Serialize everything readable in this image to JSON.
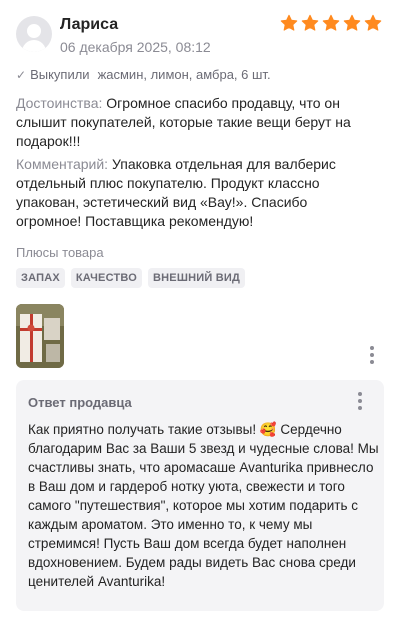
{
  "review": {
    "author": "Лариса",
    "date": "06 декабря 2025, 08:12",
    "rating": 5,
    "star_color": "#ff8a1f",
    "bought": {
      "label": "Выкупили",
      "value": "жасмин, лимон, амбра, 6 шт."
    },
    "advantages": {
      "label": "Достоинства:",
      "text": "Огромное спасибо продавцу, что он слышит покупателей, которые такие вещи берут на подарок!!!"
    },
    "comment": {
      "label": "Комментарий:",
      "text": "Упаковка отдельная для валберис отдельный плюс покупателю. Продукт классно упакован, эстетический вид «Вау!». Спасибо огромное! Поставщика рекомендую!"
    },
    "pluses_title": "Плюсы товара",
    "tags": [
      "ЗАПАХ",
      "КАЧЕСТВО",
      "ВНЕШНИЙ ВИД"
    ]
  },
  "seller_reply": {
    "title": "Ответ продавца",
    "text": "Как приятно получать такие отзывы! 🥰 Сердечно благодарим Вас за Ваши 5 звезд и чудесные слова! Мы счастливы знать, что аромасаше Avanturika привнесло в Ваш дом и гардероб нотку уюта, свежести и того самого \"путешествия\", которое мы хотим подарить с каждым ароматом. Это именно то, к чему мы стремимся! Пусть Ваш дом всегда будет наполнен вдохновением. Будем рады видеть Вас снова среди ценителей Avanturika!"
  }
}
